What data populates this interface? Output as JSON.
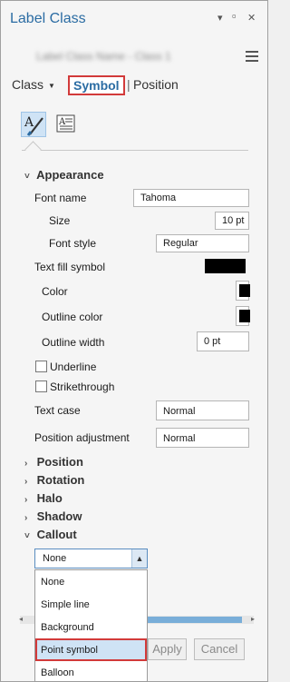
{
  "window": {
    "title": "Label Class",
    "pin_glyph": "▾",
    "restore_glyph": "▫",
    "close_glyph": "✕",
    "subtitle": "Label Class Name - Class 1"
  },
  "nav": {
    "class_label": "Class",
    "dropdown_glyph": "▼",
    "symbol_label": "Symbol",
    "separator": "|",
    "position_label": "Position"
  },
  "appearance": {
    "header": "Appearance",
    "font_name_label": "Font name",
    "font_name_value": "Tahoma",
    "size_label": "Size",
    "size_value": "10 pt",
    "font_style_label": "Font style",
    "font_style_value": "Regular",
    "text_fill_label": "Text fill symbol",
    "color_label": "Color",
    "outline_color_label": "Outline color",
    "outline_width_label": "Outline width",
    "outline_width_value": "0 pt",
    "underline_label": "Underline",
    "strikethrough_label": "Strikethrough",
    "text_case_label": "Text case",
    "text_case_value": "Normal",
    "position_adj_label": "Position adjustment",
    "position_adj_value": "Normal"
  },
  "sections": {
    "position": "Position",
    "rotation": "Rotation",
    "halo": "Halo",
    "shadow": "Shadow",
    "callout": "Callout",
    "expanded_chevron": "˅",
    "collapsed_chevron": "›"
  },
  "callout": {
    "selected": "None",
    "arrow_glyph": "▲",
    "options": [
      "None",
      "Simple line",
      "Background",
      "Point symbol",
      "Balloon"
    ]
  },
  "footer": {
    "apply_label": "Apply",
    "cancel_label": "Cancel",
    "scroll_left_glyph": "◂",
    "scroll_right_glyph": "▸"
  },
  "colors": {
    "accent": "#2b6ca3",
    "highlight_border": "#d23a3a",
    "selection": "#cfe3f5",
    "swatch": "#000000"
  }
}
